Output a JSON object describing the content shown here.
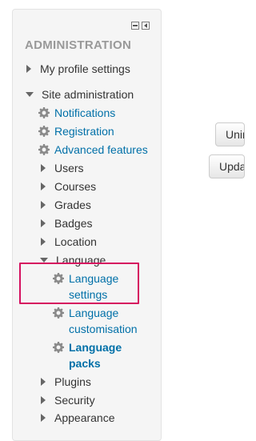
{
  "block": {
    "title": "ADMINISTRATION"
  },
  "nav": {
    "my_profile": "My profile settings",
    "site_admin": "Site administration",
    "notifications": "Notifications",
    "registration": "Registration",
    "advanced_features": "Advanced features",
    "users": "Users",
    "courses": "Courses",
    "grades": "Grades",
    "badges": "Badges",
    "location": "Location",
    "language": "Language",
    "language_settings": "Language settings",
    "language_customisation": "Language customisation",
    "language_packs": "Language packs",
    "plugins": "Plugins",
    "security": "Security",
    "appearance": "Appearance"
  },
  "buttons": {
    "btn1": "Uninstall",
    "btn2": "Update"
  },
  "colors": {
    "link": "#0070a8",
    "highlight": "#d6115f"
  }
}
